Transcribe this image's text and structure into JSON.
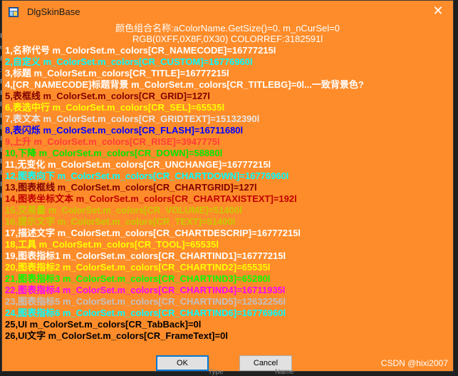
{
  "window": {
    "title": "DlgSkinBase",
    "close_glyph": "✕",
    "background": "#ff8c2a"
  },
  "left_gutter": [
    ";",
    ";",
    "F",
    "o",
    "F",
    "i",
    "F",
    "F",
    "P",
    "F",
    "F",
    "F",
    "F",
    "F",
    "F",
    "F",
    "F"
  ],
  "header": {
    "line1": "颜色组合名称:aColorName.GetSize()=0. m_nCurSel=0",
    "line2": "RGB(0XFF,0X8F,0X30)  COLORREF:3182591l"
  },
  "lines": [
    {
      "text": "1,名称代号 m_ColorSet.m_colors[CR_NAMECODE]=16777215l",
      "color": "#ffffff"
    },
    {
      "text": "2,自定义 m_ColorSet.m_colors[CR_CUSTOM]=16776960l",
      "color": "#00ffff"
    },
    {
      "text": "3,标题 m_ColorSet.m_colors[CR_TITLE]=16777215l",
      "color": "#ffffff"
    },
    {
      "text": "4,[CR_NAMECODE]标题背景 m_ColorSet.m_colors[CR_TITLEBG]=0l...一致背景色?",
      "color": "#ffffff"
    },
    {
      "text": "5,表框线 m_ColorSet.m_colors[CR_GRID]=127l",
      "color": "#800000"
    },
    {
      "text": "6,表选中行 m_ColorSet.m_colors[CR_SEL]=65535l",
      "color": "#ffff00"
    },
    {
      "text": "7,表文本 m_ColorSet.m_colors[CR_GRIDTEXT]=15132390l",
      "color": "#e6e6e6"
    },
    {
      "text": "8,表闪烁 m_ColorSet.m_colors[CR_FLASH]=16711680l",
      "color": "#0000ff"
    },
    {
      "text": "9,上升 m_ColorSet.m_colors[CR_RISE]=3947775l",
      "color": "#ff3c3c"
    },
    {
      "text": "10,下降 m_ColorSet.m_colors[CR_DOWN]=58880l",
      "color": "#00e600"
    },
    {
      "text": "11,无变化 m_ColorSet.m_colors[CR_UNCHANGE]=16777215l",
      "color": "#ffffff"
    },
    {
      "text": "12,图表向下 m_ColorSet.m_colors[CR_CHARTDOWN]=16776960l",
      "color": "#00ffff"
    },
    {
      "text": "13,图表框线 m_ColorSet.m_colors[CR_CHARTGRID]=127l",
      "color": "#800000"
    },
    {
      "text": "14,图表坐标文本 m_ColorSet.m_colors[CR_CHARTAXISTEXT]=192l",
      "color": "#c00000"
    },
    {
      "text": "15,交易量 m_ColorSet.m_colors[CR_VOLUME]=51400l",
      "color": "#c8c800"
    },
    {
      "text": "16,提示文字 m_ColorSet.m_colors[CR_TEXT]=51400l",
      "color": "#c8c800"
    },
    {
      "text": "17,描述文字 m_ColorSet.m_colors[CR_CHARTDESCRIP]=16777215l",
      "color": "#ffffff"
    },
    {
      "text": "18,工具 m_ColorSet.m_colors[CR_TOOL]=65535l",
      "color": "#ffff00"
    },
    {
      "text": "19,图表指标1 m_ColorSet.m_colors[CR_CHARTIND1]=16777215l",
      "color": "#ffffff"
    },
    {
      "text": "20,图表指标2 m_ColorSet.m_colors[CR_CHARTIND2]=65535l",
      "color": "#ffff00"
    },
    {
      "text": "21,图表指标3 m_ColorSet.m_colors[CR_CHARTIND3]=65280l",
      "color": "#00ff00"
    },
    {
      "text": "22,图表指标4 m_ColorSet.m_colors[CR_CHARTIND4]=16711935l",
      "color": "#ff00ff"
    },
    {
      "text": "23,图表指标5 m_ColorSet.m_colors[CR_CHARTIND5]=12632256l",
      "color": "#c0c0c0"
    },
    {
      "text": "24,图表指标6 m_ColorSet.m_colors[CR_CHARTIND6]=16776960l",
      "color": "#00ffff"
    },
    {
      "text": "25,UI m_ColorSet.m_colors[CR_TabBack]=0l",
      "color": "#000000"
    },
    {
      "text": "26,UI文字 m_ColorSet.m_colors[CR_FrameText]=0l",
      "color": "#000000"
    }
  ],
  "buttons": {
    "ok_label": "OK",
    "cancel_label": "Cancel"
  },
  "background_labels": {
    "type": "Type",
    "name": "Name"
  },
  "watermark": "CSDN @hixi2007"
}
